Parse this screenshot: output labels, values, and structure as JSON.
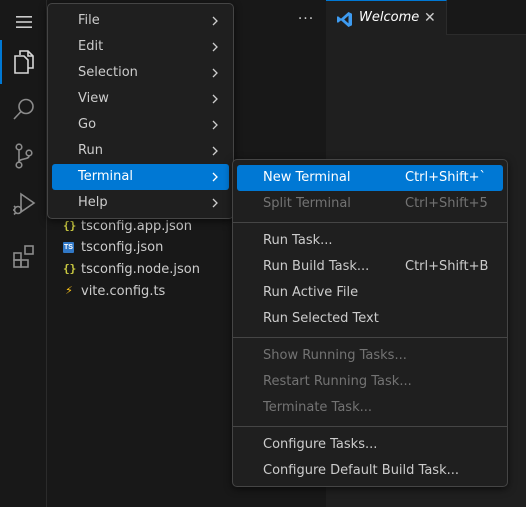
{
  "colors": {
    "accent": "#0078d4",
    "disabled_text": "#737373",
    "menu_bg": "#1f1f1f"
  },
  "activity_bar": {
    "items": [
      {
        "icon": "hamburger-menu-icon"
      },
      {
        "icon": "files-explorer-icon"
      },
      {
        "icon": "search-icon"
      },
      {
        "icon": "source-control-icon"
      },
      {
        "icon": "run-debug-icon"
      },
      {
        "icon": "extensions-icon"
      }
    ]
  },
  "sidebar": {
    "more_actions": "···",
    "files": [
      {
        "name": "tsconfig.app.json",
        "icon": "json-icon",
        "glyph": "{}"
      },
      {
        "name": "tsconfig.json",
        "icon": "ts-config-icon",
        "glyph": "TS"
      },
      {
        "name": "tsconfig.node.json",
        "icon": "json-icon",
        "glyph": "{}"
      },
      {
        "name": "vite.config.ts",
        "icon": "vite-icon",
        "glyph": "⚡"
      }
    ]
  },
  "tabs": [
    {
      "label": "Welcome",
      "close": "✕",
      "icon": "vscode-icon"
    }
  ],
  "main_menu": {
    "items": [
      {
        "label": "File"
      },
      {
        "label": "Edit"
      },
      {
        "label": "Selection"
      },
      {
        "label": "View"
      },
      {
        "label": "Go"
      },
      {
        "label": "Run"
      },
      {
        "label": "Terminal",
        "active": true
      },
      {
        "label": "Help"
      }
    ]
  },
  "terminal_submenu": {
    "groups": [
      [
        {
          "label": "New Terminal",
          "shortcut": "Ctrl+Shift+`",
          "active": true
        },
        {
          "label": "Split Terminal",
          "shortcut": "Ctrl+Shift+5",
          "disabled": true
        }
      ],
      [
        {
          "label": "Run Task..."
        },
        {
          "label": "Run Build Task...",
          "shortcut": "Ctrl+Shift+B"
        },
        {
          "label": "Run Active File"
        },
        {
          "label": "Run Selected Text"
        }
      ],
      [
        {
          "label": "Show Running Tasks...",
          "disabled": true
        },
        {
          "label": "Restart Running Task...",
          "disabled": true
        },
        {
          "label": "Terminate Task...",
          "disabled": true
        }
      ],
      [
        {
          "label": "Configure Tasks..."
        },
        {
          "label": "Configure Default Build Task..."
        }
      ]
    ]
  }
}
